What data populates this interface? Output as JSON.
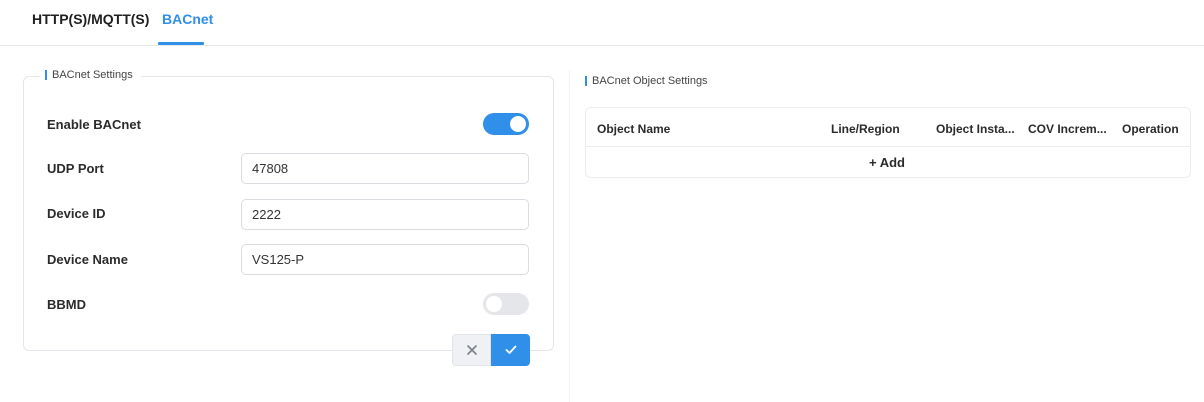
{
  "tabs": [
    {
      "label": "HTTP(S)/MQTT(S)",
      "active": false
    },
    {
      "label": "BACnet",
      "active": true
    }
  ],
  "bacnet_settings": {
    "title": "BACnet Settings",
    "enable_label": "Enable BACnet",
    "enable_value": true,
    "udp_port_label": "UDP Port",
    "udp_port_value": "47808",
    "device_id_label": "Device ID",
    "device_id_value": "2222",
    "device_name_label": "Device Name",
    "device_name_value": "VS125-P",
    "bbmd_label": "BBMD",
    "bbmd_value": false
  },
  "buttons": {
    "cancel_icon": "close-icon",
    "confirm_icon": "check-icon"
  },
  "object_settings": {
    "title": "BACnet Object Settings",
    "columns": [
      "Object Name",
      "Line/Region",
      "Object Insta...",
      "COV Increm...",
      "Operation"
    ],
    "add_label": "+ Add"
  },
  "colors": {
    "accent": "#2f8fe9",
    "toggle_off": "#e4e6ea"
  }
}
